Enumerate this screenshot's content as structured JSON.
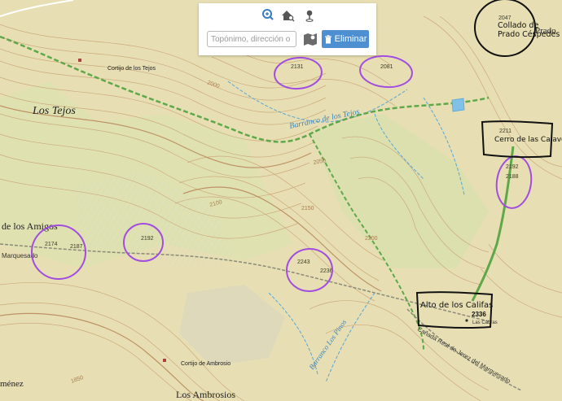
{
  "toolbar": {
    "icons": [
      "zoom-search-icon",
      "home-search-icon",
      "location-pin-icon"
    ],
    "search_placeholder": "Topónimo, dirección o cóc",
    "search_value": "",
    "delete_label": "Eliminar",
    "delete_icon": "trash-icon",
    "map_pick_icon": "map-pick-icon",
    "accent_color": "#4e8fd1"
  },
  "map": {
    "place_names": [
      "Los Tejos",
      "Cortijo de los Tejos",
      "Cortijo de Ambrosio",
      "Los Ambrosios",
      "de los Amigos",
      "Marquesado",
      "Las Cabras",
      "Collado de Prado Céspedes",
      "Prado",
      "ménez"
    ],
    "streams": [
      "Barranco de los Tejos",
      "Barranco Los Pinos"
    ],
    "tracks": [
      "Cañada Real de Jerez del Marquesado"
    ],
    "contour_labels": [
      "2000",
      "2050",
      "2100",
      "2150",
      "2200",
      "1850"
    ],
    "spot_heights": [
      "2131",
      "2081",
      "2174",
      "2187",
      "2192",
      "2243",
      "2236",
      "2047",
      "2211",
      "2192",
      "2188",
      "2336"
    ],
    "annotations": {
      "circled_purple": [
        "2131",
        "2081",
        "2174 / 2187",
        "2192",
        "2243 / 2236",
        "2192 / 2188"
      ],
      "circled_black": [
        "Collado de Prado Céspedes",
        "Cerro de las Calaveras",
        "Alto de los Califas"
      ]
    },
    "colors": {
      "terrain": "#e7dfb3",
      "contour": "#c9a073",
      "stream": "#5aa6d6",
      "path": "#5ea84a",
      "purple_marker": "#a24de0",
      "black_marker": "#111111"
    }
  }
}
